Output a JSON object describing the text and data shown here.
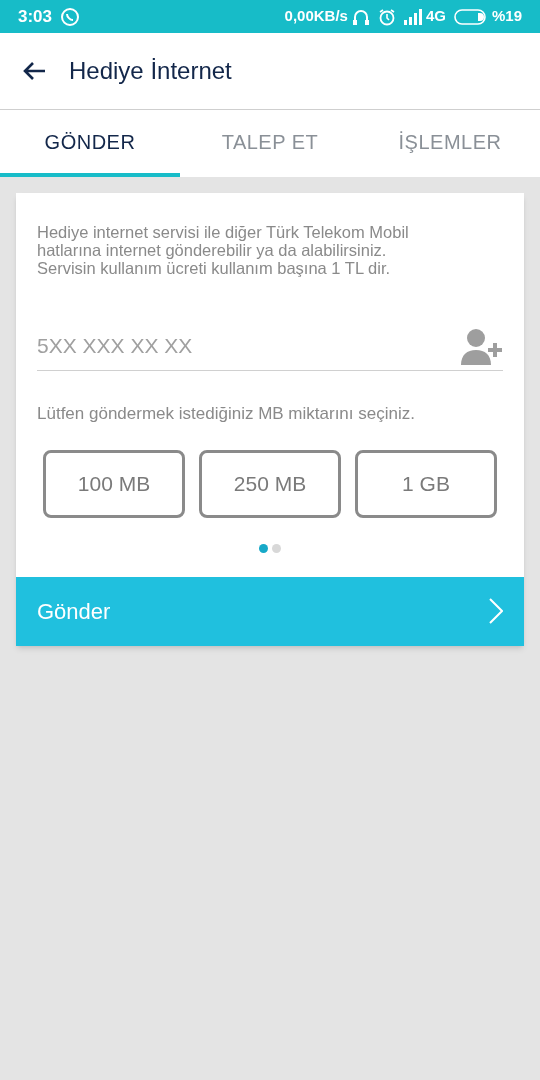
{
  "status_bar": {
    "time": "3:03",
    "speed": "0,00KB/s",
    "network": "4G",
    "battery": "%19"
  },
  "header": {
    "title": "Hediye İnternet"
  },
  "tabs": [
    {
      "label": "GÖNDER",
      "selected": true
    },
    {
      "label": "TALEP ET",
      "selected": false
    },
    {
      "label": "İŞLEMLER",
      "selected": false
    }
  ],
  "card": {
    "description": [
      "Hediye internet servisi ile diğer Türk Telekom Mobil",
      "hatlarına internet gönderebilir ya da alabilirsiniz.",
      "Servisin kullanım ücreti kullanım başına 1 TL dir."
    ],
    "phone_field": {
      "placeholder": "5XX XXX XX XX"
    },
    "prompt": "Lütfen göndermek istediğiniz MB miktarını seçiniz.",
    "options": [
      {
        "label": "100 MB",
        "selected": false
      },
      {
        "label": "250 MB",
        "selected": false
      },
      {
        "label": "1 GB",
        "selected": false
      }
    ],
    "pager": [
      {
        "selected": true
      },
      {
        "selected": false
      }
    ],
    "send_button": {
      "label": "Gönder"
    }
  }
}
